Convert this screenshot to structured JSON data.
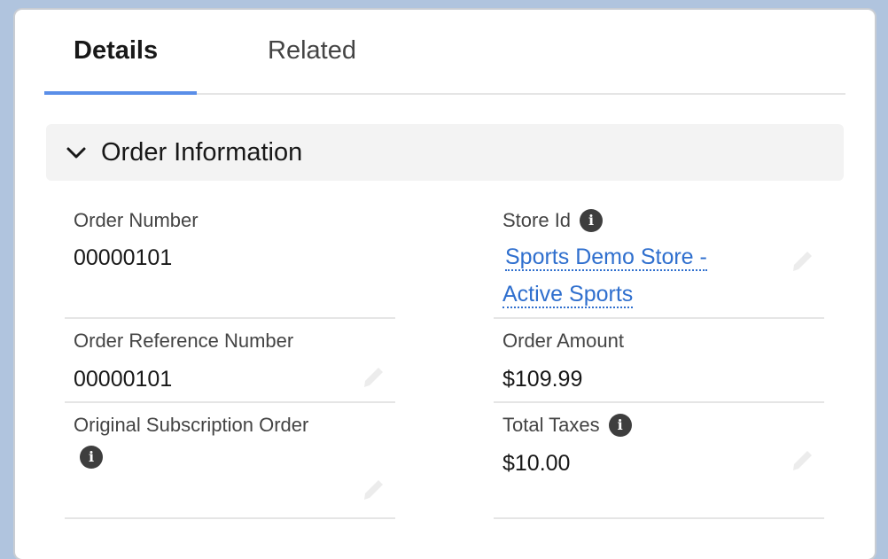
{
  "tabs": [
    {
      "label": "Details",
      "active": true
    },
    {
      "label": "Related",
      "active": false
    }
  ],
  "section": {
    "title": "Order Information",
    "icon": "chevron-down-icon"
  },
  "fields": {
    "order_number": {
      "label": "Order Number",
      "value": "00000101"
    },
    "store_id": {
      "label": "Store Id",
      "value_line1": "Sports Demo Store -",
      "value_line2": "Active Sports",
      "info_icon": "i"
    },
    "order_reference_number": {
      "label": "Order Reference Number",
      "value": "00000101"
    },
    "order_amount": {
      "label": "Order Amount",
      "value": "$109.99"
    },
    "original_subscription_order": {
      "label": "Original Subscription Order",
      "value": "",
      "info_icon": "i"
    },
    "total_taxes": {
      "label": "Total Taxes",
      "value": "$10.00",
      "info_icon": "i"
    }
  },
  "colors": {
    "accent": "#5a8ee8",
    "link": "#2f6fce",
    "background": "#b0c4de"
  }
}
